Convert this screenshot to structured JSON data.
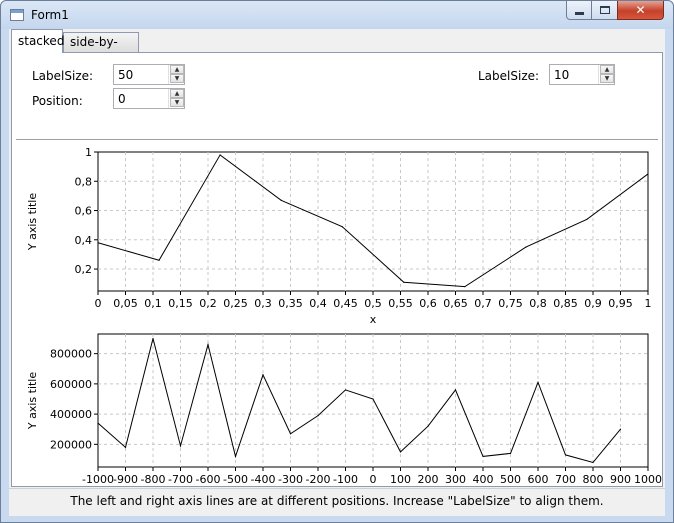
{
  "window": {
    "title": "Form1",
    "close_glyph": "✕"
  },
  "tabs": [
    {
      "label": "stacked",
      "active": true
    },
    {
      "label": "side-by-side",
      "active": false
    }
  ],
  "controls": {
    "left_labelsize_label": "LabelSize:",
    "left_labelsize_value": "50",
    "position_label": "Position:",
    "position_value": "0",
    "right_labelsize_label": "LabelSize:",
    "right_labelsize_value": "10"
  },
  "status_text": "The left and right axis lines are at different positions. Increase \"LabelSize\" to align them.",
  "chart_data": [
    {
      "type": "line",
      "ylabel": "Y axis title",
      "xlabel": "x",
      "x": [
        0,
        0.111,
        0.222,
        0.333,
        0.444,
        0.556,
        0.667,
        0.778,
        0.889,
        1.0
      ],
      "values": [
        0.38,
        0.26,
        0.98,
        0.67,
        0.49,
        0.11,
        0.08,
        0.35,
        0.54,
        0.85
      ],
      "xlim": [
        0,
        1
      ],
      "ylim": [
        0.05,
        1.0
      ],
      "xticks": [
        "0",
        "0,05",
        "0,1",
        "0,15",
        "0,2",
        "0,25",
        "0,3",
        "0,35",
        "0,4",
        "0,45",
        "0,5",
        "0,55",
        "0,6",
        "0,65",
        "0,7",
        "0,75",
        "0,8",
        "0,85",
        "0,9",
        "0,95",
        "1"
      ],
      "yticks": [
        "0,2",
        "0,4",
        "0,6",
        "0,8",
        "1"
      ],
      "grid": true
    },
    {
      "type": "line",
      "ylabel": "Y axis title",
      "xlabel": "",
      "x": [
        -1000,
        -900,
        -800,
        -700,
        -600,
        -500,
        -400,
        -300,
        -200,
        -100,
        0,
        100,
        200,
        300,
        400,
        500,
        600,
        700,
        800,
        900,
        1000
      ],
      "values": [
        340000,
        180000,
        900000,
        190000,
        860000,
        120000,
        660000,
        270000,
        390000,
        560000,
        500000,
        150000,
        320000,
        560000,
        120000,
        140000,
        610000,
        130000,
        80000,
        300000
      ],
      "xlim": [
        -1000,
        1000
      ],
      "ylim": [
        50000,
        930000
      ],
      "xticks": [
        "-1000",
        "-900",
        "-800",
        "-700",
        "-600",
        "-500",
        "-400",
        "-300",
        "-200",
        "-100",
        "0",
        "100",
        "200",
        "300",
        "400",
        "500",
        "600",
        "700",
        "800",
        "900",
        "1000"
      ],
      "yticks": [
        "200000",
        "400000",
        "600000",
        "800000"
      ],
      "grid": true
    }
  ]
}
